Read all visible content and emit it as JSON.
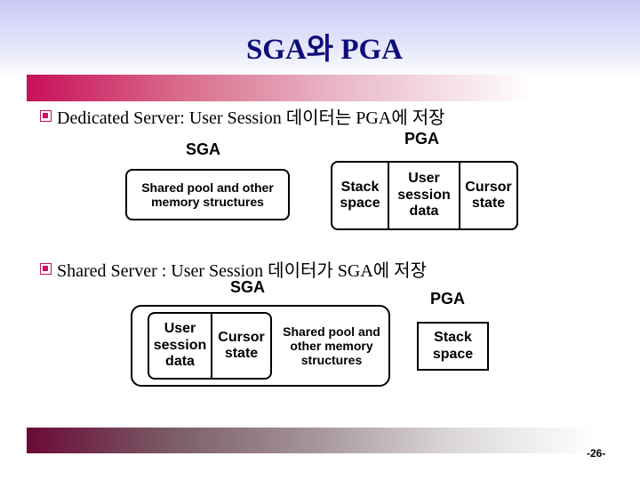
{
  "slide": {
    "title": "SGA와 PGA",
    "page_number": "-26-"
  },
  "section1": {
    "bullet": "Dedicated Server: User Session 데이터는 PGA에 저장",
    "sga": {
      "label": "SGA",
      "box_line1": "Shared pool and other",
      "box_line2": "memory structures"
    },
    "pga": {
      "label": "PGA",
      "cells": [
        {
          "line1": "Stack",
          "line2": "space",
          "line3": ""
        },
        {
          "line1": "User",
          "line2": "session",
          "line3": "data"
        },
        {
          "line1": "Cursor",
          "line2": "state",
          "line3": ""
        }
      ]
    }
  },
  "section2": {
    "bullet": "Shared Server : User Session 데이터가 SGA에 저장",
    "sga": {
      "label": "SGA",
      "inner_cells": [
        {
          "line1": "User",
          "line2": "session",
          "line3": "data"
        },
        {
          "line1": "Cursor",
          "line2": "state",
          "line3": ""
        }
      ],
      "shared_line1": "Shared pool and",
      "shared_line2": "other memory",
      "shared_line3": "structures"
    },
    "pga": {
      "label": "PGA",
      "line1": "Stack",
      "line2": "space"
    }
  }
}
